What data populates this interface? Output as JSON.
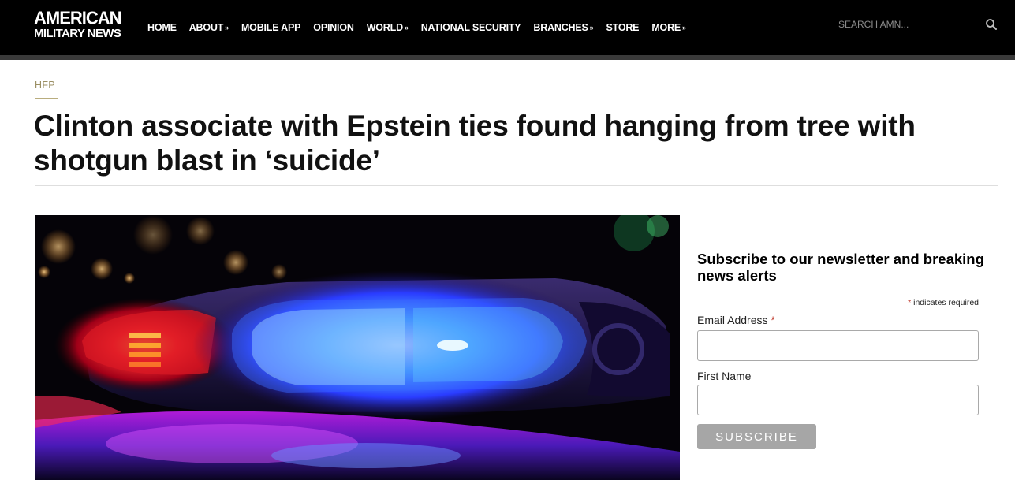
{
  "header": {
    "logo_line1": "AMERICAN",
    "logo_line2": "MILITARY NEWS",
    "nav": [
      {
        "label": "HOME",
        "has_submenu": false
      },
      {
        "label": "ABOUT",
        "has_submenu": true
      },
      {
        "label": "MOBILE APP",
        "has_submenu": false
      },
      {
        "label": "OPINION",
        "has_submenu": false
      },
      {
        "label": "WORLD",
        "has_submenu": true
      },
      {
        "label": "NATIONAL SECURITY",
        "has_submenu": false
      },
      {
        "label": "BRANCHES",
        "has_submenu": true
      },
      {
        "label": "STORE",
        "has_submenu": false
      },
      {
        "label": "MORE",
        "has_submenu": true
      }
    ],
    "submenu_glyph": "»",
    "search": {
      "placeholder": "SEARCH AMN...",
      "value": "",
      "icon": "search-icon"
    }
  },
  "article": {
    "category": "HFP",
    "title": "Clinton associate with Epstein ties found hanging from tree with shotgun blast in ‘suicide’"
  },
  "newsletter": {
    "title": "Subscribe to our newsletter and breaking news alerts",
    "required_mark": "*",
    "required_note": "indicates required",
    "email_label": "Email Address",
    "email_value": "",
    "first_name_label": "First Name",
    "first_name_value": "",
    "subscribe_label": "SUBSCRIBE"
  },
  "colors": {
    "header_bg": "#000000",
    "category": "#9b8f63",
    "button_bg": "#a6a6a6",
    "required": "#c0392b"
  }
}
